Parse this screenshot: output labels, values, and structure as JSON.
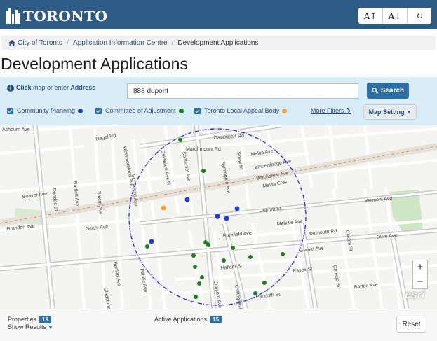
{
  "header": {
    "logo_text": "TORONTO",
    "tools": [
      {
        "label": "A↑",
        "icon": "increase-font-icon"
      },
      {
        "label": "A↓",
        "icon": "decrease-font-icon"
      },
      {
        "label": "↻",
        "icon": "refresh-icon"
      }
    ]
  },
  "breadcrumb": {
    "home": "City of Toronto",
    "level2": "Application Information Centre",
    "current": "Development Applications"
  },
  "page_title": "Development Applications",
  "search": {
    "hint_click": "Click",
    "hint_middle": "map or enter",
    "hint_address": "Address",
    "value": "888 dupont",
    "button": "Search"
  },
  "filters": [
    {
      "label": "Community Planning",
      "color": "#1f3fd6"
    },
    {
      "label": "Committee of Adjustment",
      "color": "#1e7d1e"
    },
    {
      "label": "Toronto Local Appeal Body",
      "color": "#f2a12b"
    }
  ],
  "more_filters": "More Filters",
  "map_setting": "Map Setting",
  "map": {
    "streets": [
      "Ashburn Ave",
      "Regal Rd",
      "Davenport Rd",
      "Marchmount Rd",
      "Melita Ave",
      "Lambertlodge Ave",
      "Wychcrest Ave",
      "Melita Cres",
      "Beaver Ave",
      "Dundas St",
      "Bartlett Ave",
      "Salem Ave",
      "St Clarens Ave",
      "Westmoreland Ave",
      "Delaware Ave N",
      "Somerset Ave",
      "Shaw St",
      "Symington Ave",
      "Geary Ave",
      "Dupont St",
      "Vermont Ave",
      "Brandon Ave",
      "Melville Ave",
      "Burnfield Ave",
      "Yarmouth Rd",
      "Olive Ave",
      "Garnet Ave",
      "Essex St",
      "Hallam St",
      "Barton Ave",
      "Pendrith St",
      "Clinton St",
      "Concord Ave",
      "Ossington Ave",
      "Christie St",
      "Gladstone Ave",
      "Pacific Ave",
      "Bartlett Ave"
    ],
    "markers": {
      "community_planning": 6,
      "committee_of_adjustment": 17,
      "local_appeal_body": 1
    },
    "zoom_in": "+",
    "zoom_out": "−",
    "attribution": "esri"
  },
  "footer": {
    "properties_label": "Properties",
    "properties_count": "19",
    "show_results": "Show Results",
    "active_label": "Active Applications",
    "active_count": "15",
    "reset": "Reset"
  }
}
